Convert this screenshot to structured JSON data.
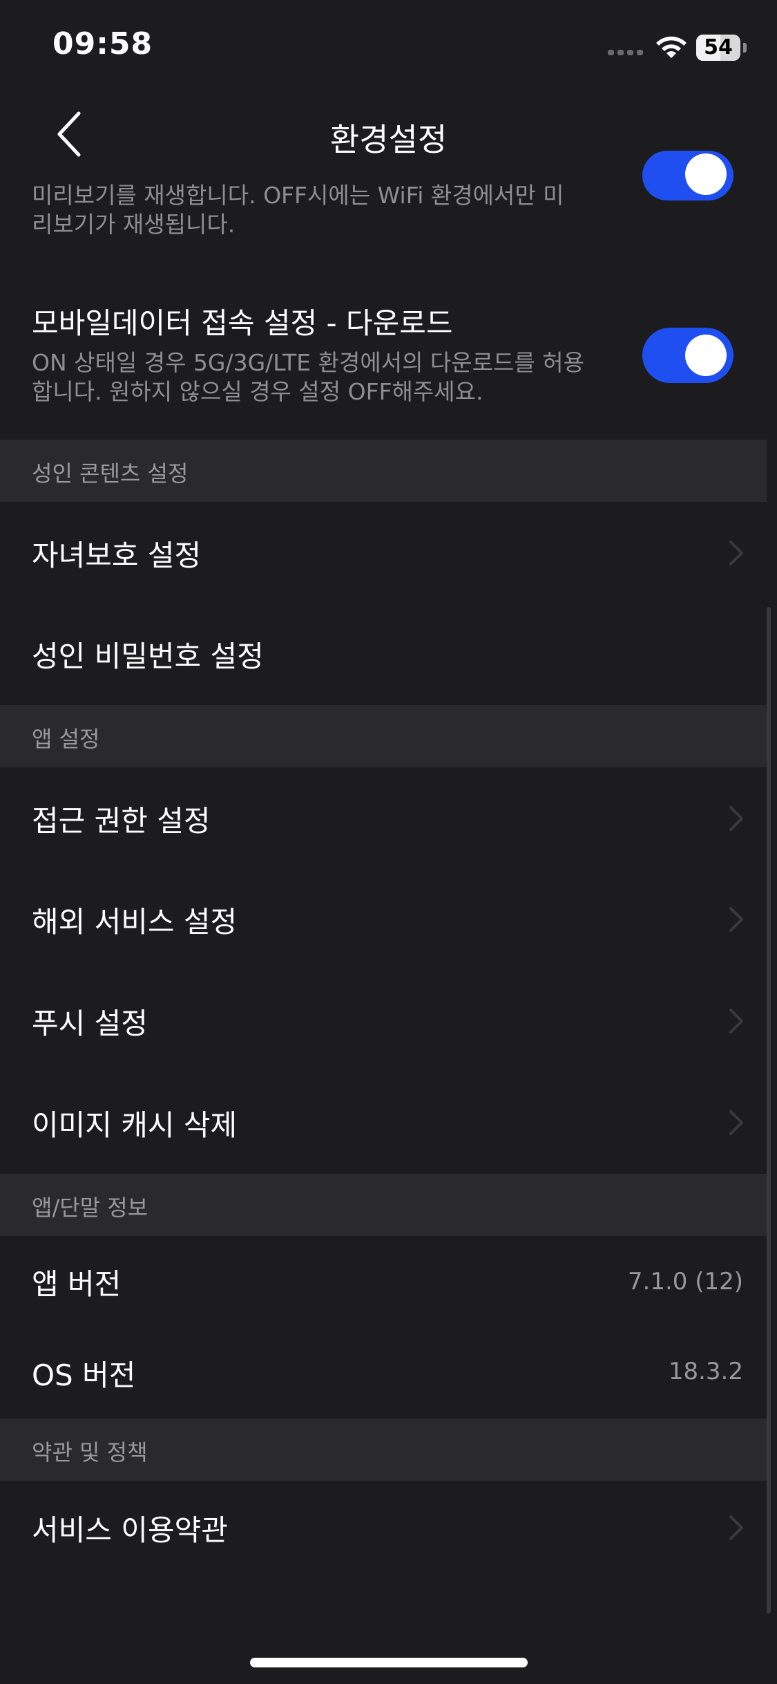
{
  "status_bar": {
    "time": "09:58",
    "battery_percent": "54",
    "battery_level": 0.54,
    "icons": [
      "signal-dots-icon",
      "wifi-icon",
      "battery-icon"
    ]
  },
  "nav": {
    "title": "환경설정",
    "back_icon": "chevron-left-icon"
  },
  "preview_setting": {
    "description": "미리보기를 재생합니다. OFF시에는 WiFi 환경에서만 미리보기가 재생됩니다.",
    "toggle_on": true
  },
  "mobile_download_setting": {
    "label": "모바일데이터 접속 설정 - 다운로드",
    "description": "ON 상태일 경우 5G/3G/LTE 환경에서의 다운로드를 허용합니다. 원하지 않으실 경우 설정 OFF해주세요.",
    "toggle_on": true
  },
  "sections": [
    {
      "header": "성인 콘텐츠 설정",
      "items": [
        {
          "label": "자녀보호 설정",
          "chevron": true
        },
        {
          "label": "성인 비밀번호 설정",
          "chevron": false
        }
      ]
    },
    {
      "header": "앱 설정",
      "items": [
        {
          "label": "접근 권한 설정",
          "chevron": true
        },
        {
          "label": "해외 서비스 설정",
          "chevron": true
        },
        {
          "label": "푸시 설정",
          "chevron": true
        },
        {
          "label": "이미지 캐시 삭제",
          "chevron": true
        }
      ]
    },
    {
      "header": "앱/단말 정보",
      "items": [
        {
          "label": "앱 버전",
          "value": "7.1.0 (12)"
        },
        {
          "label": "OS 버전",
          "value": "18.3.2"
        }
      ]
    },
    {
      "header": "약관 및 정책",
      "items": [
        {
          "label": "서비스 이용약관",
          "chevron": true
        }
      ]
    }
  ],
  "colors": {
    "background": "#1c1c1e",
    "section_header_bg": "#2a2a2c",
    "toggle_on": "#1f4ff0",
    "secondary_text": "#8e8e93"
  }
}
